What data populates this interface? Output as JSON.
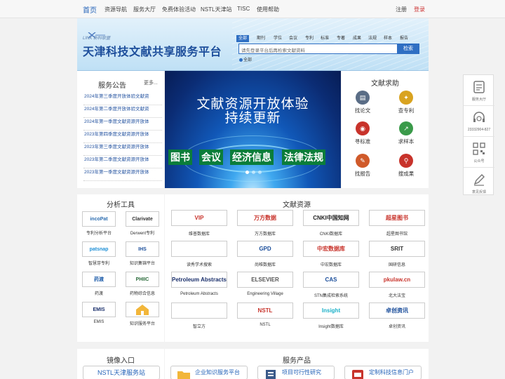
{
  "topnav": {
    "home": "首页",
    "items": [
      "资源导航",
      "服务大厅",
      "免费体验活动",
      "NSTL天津站",
      "TISC",
      "使用帮助"
    ],
    "register": "注册",
    "login": "登录"
  },
  "banner": {
    "logo_sub": "LINK 新科联盟",
    "title": "天津科技文献共享服务平台",
    "search_tabs": [
      "全部",
      "期刊",
      "学位",
      "会议",
      "专利",
      "标准",
      "专著",
      "成果",
      "法规",
      "样本",
      "报告"
    ],
    "search_placeholder": "请先登录平台后再检索文献资料",
    "search_button": "检索",
    "radio_label": "全部"
  },
  "announcements": {
    "title": "服务公告",
    "more": "更多...",
    "items": [
      "2024年第三季度开放体验文献资",
      "2024年第二季度开放体验文献资",
      "2024年第一季度文献资源开放体",
      "2023年第四季度文献资源开放体",
      "2023年第三季度文献资源开放体",
      "2023年第二季度文献资源开放体",
      "2023年第一季度文献资源开放体"
    ]
  },
  "hero": {
    "line1": "文献资源开放体验",
    "line2": "持续更新",
    "tags": [
      "图书",
      "会议",
      "经济信息",
      "法律法规"
    ]
  },
  "request": {
    "title": "文献求助",
    "items": [
      {
        "label": "找论文",
        "icon": "paper-icon",
        "color": "#5a6d86"
      },
      {
        "label": "查专利",
        "icon": "patent-icon",
        "color": "#d9a320"
      },
      {
        "label": "寻标准",
        "icon": "standard-icon",
        "color": "#c8332b"
      },
      {
        "label": "求样本",
        "icon": "sample-icon",
        "color": "#3a9a4a"
      },
      {
        "label": "找报告",
        "icon": "report-icon",
        "color": "#d05a2a"
      },
      {
        "label": "搜成果",
        "icon": "achievement-icon",
        "color": "#c8332b"
      }
    ]
  },
  "tools": {
    "title": "分析工具",
    "items": [
      {
        "logo": "incoPat",
        "label": "专利分析平台",
        "color": "#2b6cb0"
      },
      {
        "logo": "Clarivate",
        "label": "Derwent专利",
        "color": "#333333"
      },
      {
        "logo": "patsnap",
        "label": "智慧芽专利",
        "color": "#1e8fd6"
      },
      {
        "logo": "IHS",
        "label": "知识集锦平台",
        "color": "#1a4d9a"
      },
      {
        "logo": "药渡",
        "label": "药渡",
        "color": "#1a5aa8"
      },
      {
        "logo": "PHIIC",
        "label": "药物综合信息",
        "color": "#2a6a3a"
      },
      {
        "logo": "EMIS",
        "label": "EMIS",
        "color": "#1a2f6b"
      },
      {
        "logo": "",
        "label": "知识服务平台",
        "color": "#e8a020"
      }
    ]
  },
  "resources": {
    "title": "文献资源",
    "items": [
      {
        "logo": "VIP",
        "label": "维普数据库",
        "color": "#c8332b"
      },
      {
        "logo": "万方数据",
        "label": "万方数据库",
        "color": "#c8332b"
      },
      {
        "logo": "CNKI中国知网",
        "label": "CNKI数据库",
        "color": "#222222"
      },
      {
        "logo": "超星图书",
        "label": "超星图书馆",
        "color": "#c8332b"
      },
      {
        "logo": "",
        "label": "读秀学术搜索",
        "color": "#2a8ac0"
      },
      {
        "logo": "GPD",
        "label": "尚唯数据库",
        "color": "#1a4d9a"
      },
      {
        "logo": "中宏数据库",
        "label": "中宏数据库",
        "color": "#c8332b"
      },
      {
        "logo": "SRIT",
        "label": "国研信息",
        "color": "#333333"
      },
      {
        "logo": "Petroleum Abstracts",
        "label": "Petroleum Abstracts",
        "color": "#1a2f6b"
      },
      {
        "logo": "ELSEVIER",
        "label": "Engineering Village",
        "color": "#555555"
      },
      {
        "logo": "CAS",
        "label": "STN集成检索系统",
        "color": "#1a4d9a"
      },
      {
        "logo": "pkulaw.cn",
        "label": "北大法宝",
        "color": "#c8332b"
      },
      {
        "logo": "",
        "label": "智立方",
        "color": "#2a6ad0"
      },
      {
        "logo": "NSTL",
        "label": "NSTL",
        "color": "#c8332b"
      },
      {
        "logo": "Insight",
        "label": "Insight数据库",
        "color": "#1ab0c8"
      },
      {
        "logo": "卓创资讯",
        "label": "卓创资讯",
        "color": "#1a4d9a"
      }
    ]
  },
  "mirror": {
    "title": "镜像入口",
    "button": "NSTL天津服务站"
  },
  "services": {
    "title": "服务产品",
    "items": [
      "企业知识服务平台",
      "项目可行性研究",
      "定制科技信息门户"
    ]
  },
  "sidebar": {
    "items": [
      {
        "label": "服务大厅",
        "icon": "service-hall-icon"
      },
      {
        "label": "23332904-827",
        "icon": "headset-icon"
      },
      {
        "label": "公众号",
        "icon": "qrcode-icon"
      },
      {
        "label": "意见反馈",
        "icon": "feedback-icon"
      }
    ]
  }
}
